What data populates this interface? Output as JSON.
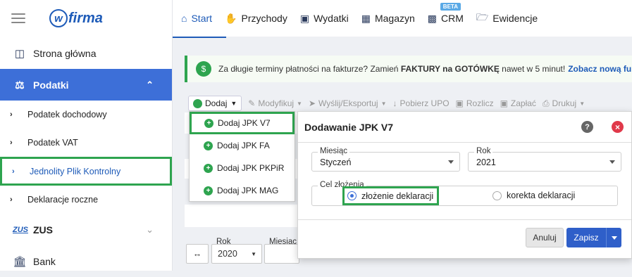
{
  "app": {
    "logo_text": "firma",
    "logo_letter": "w"
  },
  "sidebar": {
    "items": [
      {
        "label": "Strona główna"
      },
      {
        "label": "Podatki"
      },
      {
        "label": "Podatek dochodowy"
      },
      {
        "label": "Podatek VAT"
      },
      {
        "label": "Jednolity Plik Kontrolny"
      },
      {
        "label": "Deklaracje roczne"
      },
      {
        "label": "ZUS"
      },
      {
        "label": "Bank"
      }
    ]
  },
  "topnav": {
    "tabs": [
      {
        "label": "Start"
      },
      {
        "label": "Przychody"
      },
      {
        "label": "Wydatki"
      },
      {
        "label": "Magazyn"
      },
      {
        "label": "CRM",
        "badge": "BETA"
      },
      {
        "label": "Ewidencje"
      }
    ]
  },
  "banner": {
    "text_a": "Za długie terminy płatności na fakturze? Zamień",
    "bold_a": "FAKTURY na GOTÓWKĘ",
    "text_b": "nawet w 5 minut!",
    "link": "Zobacz nową funkcję"
  },
  "toolbar": {
    "add": "Dodaj",
    "modify": "Modyfikuj",
    "send": "Wyślij/Eksportuj",
    "upo": "Pobierz UPO",
    "settle": "Rozlicz",
    "pay": "Zapłać",
    "print": "Drukuj"
  },
  "dropdown": {
    "items": [
      {
        "label": "Dodaj JPK V7"
      },
      {
        "label": "Dodaj JPK FA"
      },
      {
        "label": "Dodaj JPK PKPiR"
      },
      {
        "label": "Dodaj JPK MAG"
      }
    ]
  },
  "filter": {
    "year_label": "Rok",
    "year_value": "2020",
    "month_label": "Miesiąc"
  },
  "dialog": {
    "title": "Dodawanie JPK V7",
    "month_label": "Miesiąc",
    "month_value": "Styczeń",
    "year_label": "Rok",
    "year_value": "2021",
    "purpose_label": "Cel złożenia",
    "option_submit": "złożenie deklaracji",
    "option_correct": "korekta deklaracji",
    "cancel": "Anuluj",
    "save": "Zapisz"
  },
  "colors": {
    "accent": "#3d6fd8",
    "highlight": "#2ea44f",
    "danger": "#e0394a"
  }
}
